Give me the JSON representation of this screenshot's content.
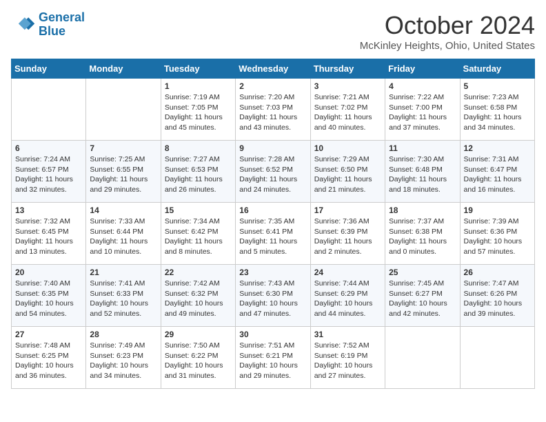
{
  "header": {
    "logo_line1": "General",
    "logo_line2": "Blue",
    "month_title": "October 2024",
    "location": "McKinley Heights, Ohio, United States"
  },
  "days_of_week": [
    "Sunday",
    "Monday",
    "Tuesday",
    "Wednesday",
    "Thursday",
    "Friday",
    "Saturday"
  ],
  "weeks": [
    [
      {
        "day": "",
        "content": ""
      },
      {
        "day": "",
        "content": ""
      },
      {
        "day": "1",
        "content": "Sunrise: 7:19 AM\nSunset: 7:05 PM\nDaylight: 11 hours and 45 minutes."
      },
      {
        "day": "2",
        "content": "Sunrise: 7:20 AM\nSunset: 7:03 PM\nDaylight: 11 hours and 43 minutes."
      },
      {
        "day": "3",
        "content": "Sunrise: 7:21 AM\nSunset: 7:02 PM\nDaylight: 11 hours and 40 minutes."
      },
      {
        "day": "4",
        "content": "Sunrise: 7:22 AM\nSunset: 7:00 PM\nDaylight: 11 hours and 37 minutes."
      },
      {
        "day": "5",
        "content": "Sunrise: 7:23 AM\nSunset: 6:58 PM\nDaylight: 11 hours and 34 minutes."
      }
    ],
    [
      {
        "day": "6",
        "content": "Sunrise: 7:24 AM\nSunset: 6:57 PM\nDaylight: 11 hours and 32 minutes."
      },
      {
        "day": "7",
        "content": "Sunrise: 7:25 AM\nSunset: 6:55 PM\nDaylight: 11 hours and 29 minutes."
      },
      {
        "day": "8",
        "content": "Sunrise: 7:27 AM\nSunset: 6:53 PM\nDaylight: 11 hours and 26 minutes."
      },
      {
        "day": "9",
        "content": "Sunrise: 7:28 AM\nSunset: 6:52 PM\nDaylight: 11 hours and 24 minutes."
      },
      {
        "day": "10",
        "content": "Sunrise: 7:29 AM\nSunset: 6:50 PM\nDaylight: 11 hours and 21 minutes."
      },
      {
        "day": "11",
        "content": "Sunrise: 7:30 AM\nSunset: 6:48 PM\nDaylight: 11 hours and 18 minutes."
      },
      {
        "day": "12",
        "content": "Sunrise: 7:31 AM\nSunset: 6:47 PM\nDaylight: 11 hours and 16 minutes."
      }
    ],
    [
      {
        "day": "13",
        "content": "Sunrise: 7:32 AM\nSunset: 6:45 PM\nDaylight: 11 hours and 13 minutes."
      },
      {
        "day": "14",
        "content": "Sunrise: 7:33 AM\nSunset: 6:44 PM\nDaylight: 11 hours and 10 minutes."
      },
      {
        "day": "15",
        "content": "Sunrise: 7:34 AM\nSunset: 6:42 PM\nDaylight: 11 hours and 8 minutes."
      },
      {
        "day": "16",
        "content": "Sunrise: 7:35 AM\nSunset: 6:41 PM\nDaylight: 11 hours and 5 minutes."
      },
      {
        "day": "17",
        "content": "Sunrise: 7:36 AM\nSunset: 6:39 PM\nDaylight: 11 hours and 2 minutes."
      },
      {
        "day": "18",
        "content": "Sunrise: 7:37 AM\nSunset: 6:38 PM\nDaylight: 11 hours and 0 minutes."
      },
      {
        "day": "19",
        "content": "Sunrise: 7:39 AM\nSunset: 6:36 PM\nDaylight: 10 hours and 57 minutes."
      }
    ],
    [
      {
        "day": "20",
        "content": "Sunrise: 7:40 AM\nSunset: 6:35 PM\nDaylight: 10 hours and 54 minutes."
      },
      {
        "day": "21",
        "content": "Sunrise: 7:41 AM\nSunset: 6:33 PM\nDaylight: 10 hours and 52 minutes."
      },
      {
        "day": "22",
        "content": "Sunrise: 7:42 AM\nSunset: 6:32 PM\nDaylight: 10 hours and 49 minutes."
      },
      {
        "day": "23",
        "content": "Sunrise: 7:43 AM\nSunset: 6:30 PM\nDaylight: 10 hours and 47 minutes."
      },
      {
        "day": "24",
        "content": "Sunrise: 7:44 AM\nSunset: 6:29 PM\nDaylight: 10 hours and 44 minutes."
      },
      {
        "day": "25",
        "content": "Sunrise: 7:45 AM\nSunset: 6:27 PM\nDaylight: 10 hours and 42 minutes."
      },
      {
        "day": "26",
        "content": "Sunrise: 7:47 AM\nSunset: 6:26 PM\nDaylight: 10 hours and 39 minutes."
      }
    ],
    [
      {
        "day": "27",
        "content": "Sunrise: 7:48 AM\nSunset: 6:25 PM\nDaylight: 10 hours and 36 minutes."
      },
      {
        "day": "28",
        "content": "Sunrise: 7:49 AM\nSunset: 6:23 PM\nDaylight: 10 hours and 34 minutes."
      },
      {
        "day": "29",
        "content": "Sunrise: 7:50 AM\nSunset: 6:22 PM\nDaylight: 10 hours and 31 minutes."
      },
      {
        "day": "30",
        "content": "Sunrise: 7:51 AM\nSunset: 6:21 PM\nDaylight: 10 hours and 29 minutes."
      },
      {
        "day": "31",
        "content": "Sunrise: 7:52 AM\nSunset: 6:19 PM\nDaylight: 10 hours and 27 minutes."
      },
      {
        "day": "",
        "content": ""
      },
      {
        "day": "",
        "content": ""
      }
    ]
  ]
}
